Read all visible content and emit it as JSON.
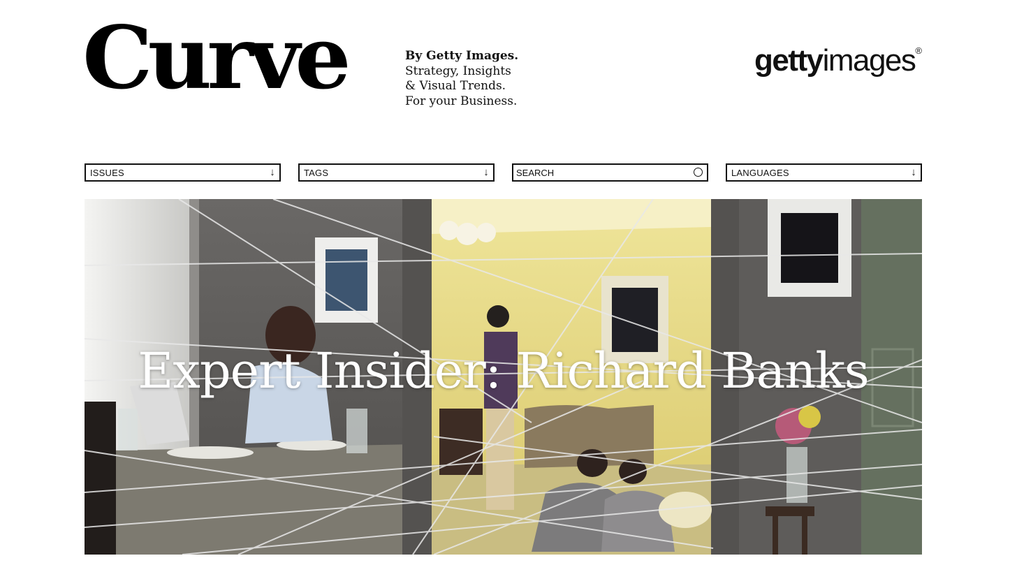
{
  "brand": {
    "logo_text": "Curve",
    "byline": "By Getty Images.",
    "tagline_lines": [
      "Strategy, Insights",
      "& Visual Trends.",
      "For your Business."
    ],
    "partner_logo": {
      "bold": "getty",
      "regular": "images",
      "mark": "®"
    }
  },
  "nav": {
    "issues_label": "ISSUES",
    "tags_label": "TAGS",
    "search_placeholder": "SEARCH",
    "search_value": "",
    "languages_label": "LANGUAGES",
    "dropdown_icon": "↓"
  },
  "hero": {
    "title": "Expert Insider: Richard Banks"
  },
  "colors": {
    "wall_grey": "#5f5d5b",
    "wall_yellow": "#e6d97c",
    "door_green": "#65705f",
    "string": "#e8e8e8"
  }
}
